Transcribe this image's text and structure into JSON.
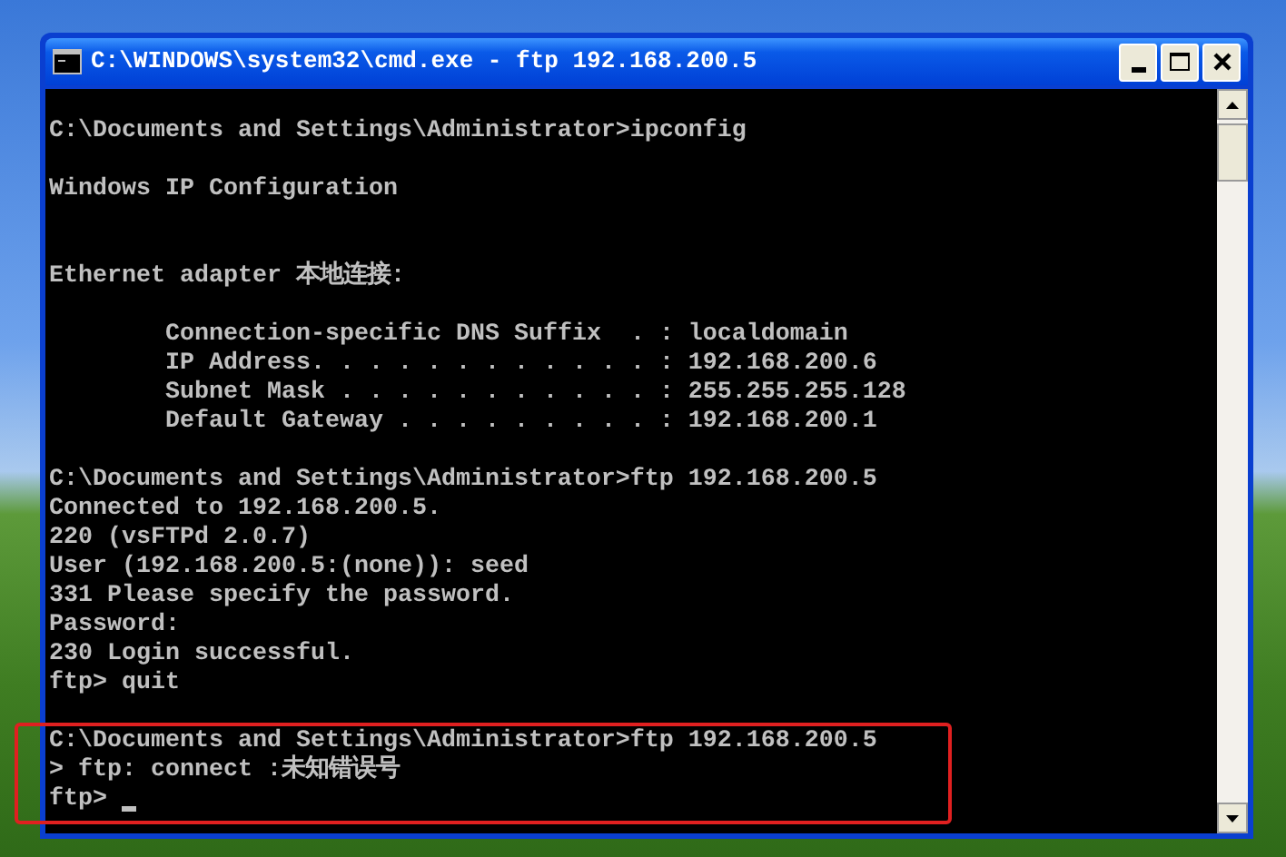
{
  "window": {
    "title": "C:\\WINDOWS\\system32\\cmd.exe - ftp 192.168.200.5"
  },
  "console": {
    "blocks": [
      {
        "kind": "plain",
        "indented": false,
        "lines": [
          "C:\\Documents and Settings\\Administrator>ipconfig"
        ]
      },
      {
        "kind": "header",
        "indented": false,
        "lines": [
          "Windows IP Configuration"
        ]
      },
      {
        "kind": "plain",
        "indented": false,
        "lines": [
          "Ethernet adapter 本地连接:"
        ]
      },
      {
        "kind": "plain",
        "indented": true,
        "lines": [
          "Connection-specific DNS Suffix  . : localdomain",
          "IP Address. . . . . . . . . . . . : 192.168.200.6",
          "Subnet Mask . . . . . . . . . . . : 255.255.255.128",
          "Default Gateway . . . . . . . . . : 192.168.200.1"
        ]
      },
      {
        "kind": "plain",
        "indented": false,
        "lines": [
          "C:\\Documents and Settings\\Administrator>ftp 192.168.200.5",
          "Connected to 192.168.200.5.",
          "220 (vsFTPd 2.0.7)",
          "User (192.168.200.5:(none)): seed",
          "331 Please specify the password.",
          "Password:",
          "230 Login successful.",
          "ftp> quit"
        ]
      },
      {
        "kind": "plain",
        "indented": false,
        "lines": [
          "C:\\Documents and Settings\\Administrator>ftp 192.168.200.5",
          "> ftp: connect :未知错误号",
          "ftp>"
        ]
      }
    ],
    "cursor": true
  }
}
